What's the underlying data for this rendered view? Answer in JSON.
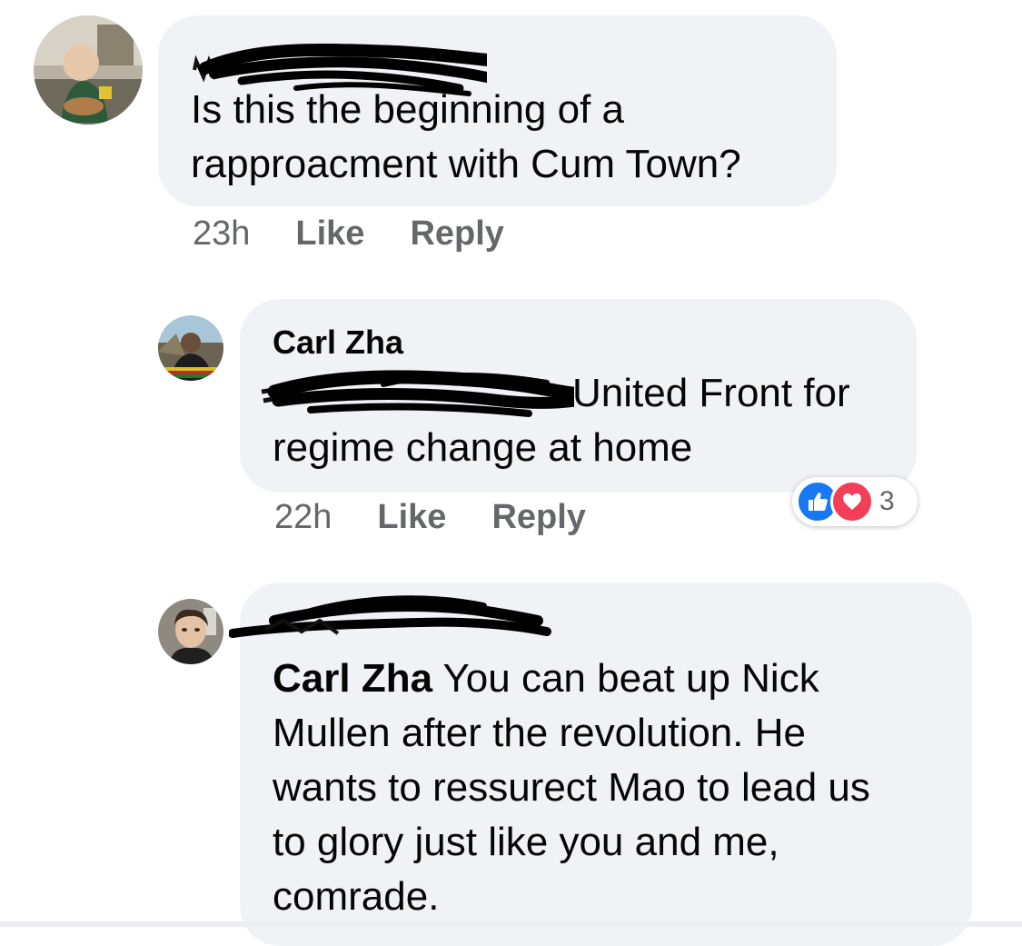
{
  "comments": [
    {
      "author_visible": "",
      "text": "Is this the beginning of a rapproacment with Cum Town?",
      "line1": "Is this the beginning of a",
      "line2": "rapproacment with Cum Town?",
      "time": "23h",
      "like": "Like",
      "reply": "Reply",
      "avatar_icon": "avatar-photo-child"
    },
    {
      "author": "Carl Zha",
      "line1": "United Front for",
      "line2": "regime change at home",
      "time": "22h",
      "like": "Like",
      "reply": "Reply",
      "avatar_icon": "avatar-photo-man",
      "reaction_count": "3",
      "reaction_icons": [
        "like-icon",
        "love-icon"
      ]
    },
    {
      "author_mention": "Carl Zha",
      "line1_rest": " You can beat up Nick",
      "line2": "Mullen after the revolution. He",
      "line3": "wants to ressurect Mao to lead us",
      "line4": "to glory just like you and me,",
      "line5": "comrade.",
      "avatar_icon": "avatar-photo-young-man"
    }
  ],
  "colors": {
    "bubble": "#f0f2f5",
    "meta": "#65676b",
    "like_blue": "#1877f2",
    "love_red": "#f33e58"
  }
}
